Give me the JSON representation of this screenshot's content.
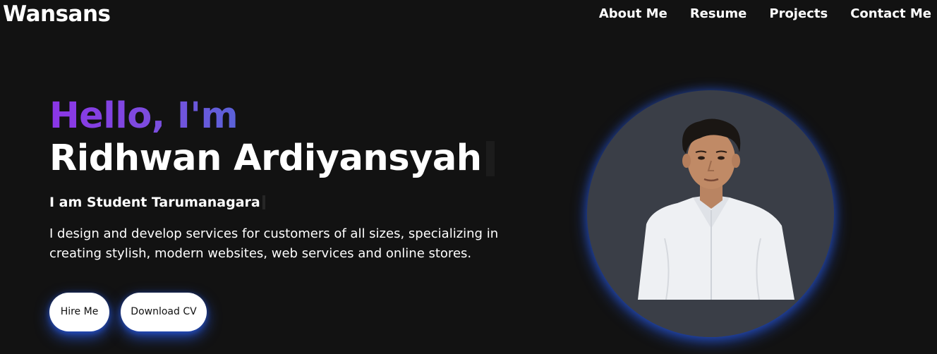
{
  "nav": {
    "brand": "Wansans",
    "links": [
      "About Me",
      "Resume",
      "Projects",
      "Contact Me"
    ]
  },
  "hero": {
    "greeting": "Hello, I'm",
    "name": "Ridhwan Ardiyansyah",
    "role": "I am Student Tarumanagara",
    "description": "I design and develop services for customers of all sizes, specializing in creating stylish, modern websites, web services and online stores.",
    "buttons": {
      "hire": "Hire Me",
      "cv": "Download CV"
    }
  },
  "colors": {
    "background": "#121212",
    "greeting_gradient_start": "#8b35e6",
    "greeting_gradient_end": "#5a62d8",
    "glow": "#285ae6",
    "avatar_bg": "#3a3e47"
  }
}
